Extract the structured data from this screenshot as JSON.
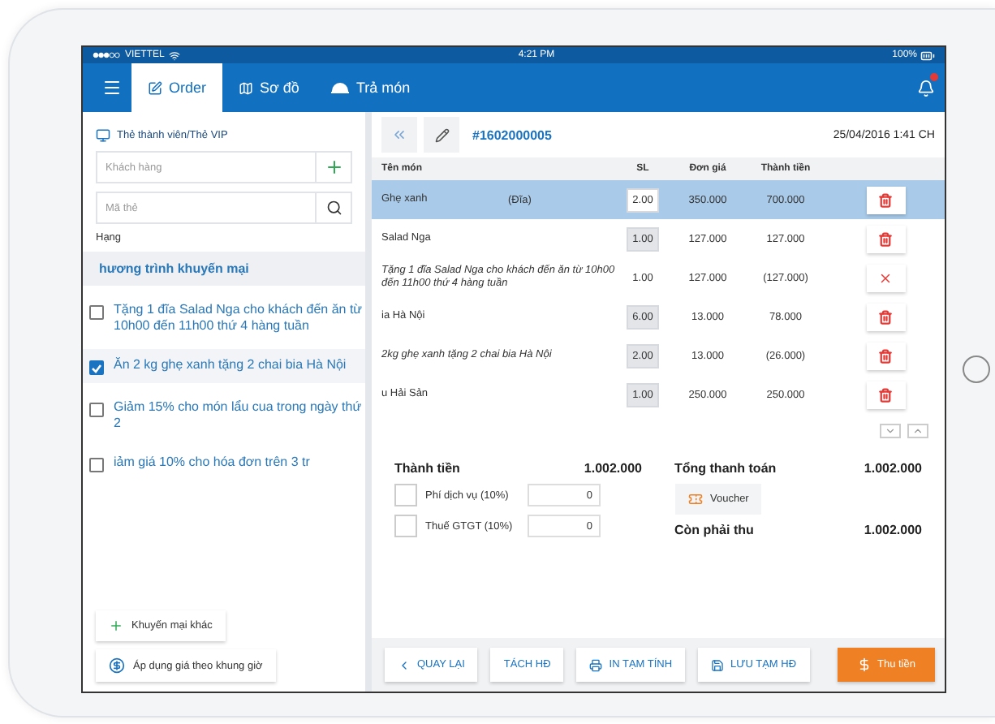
{
  "status_bar": {
    "carrier": "VIETTEL",
    "time": "4:21 PM",
    "battery": "100%"
  },
  "nav": {
    "tabs": [
      {
        "label": "Order",
        "selected": true
      },
      {
        "label": "Sơ đồ",
        "selected": false
      },
      {
        "label": "Trả món",
        "selected": false
      }
    ]
  },
  "left_panel": {
    "member_title": "Thẻ thành viên/Thẻ VIP",
    "customer_field": {
      "placeholder": "Khách hàng"
    },
    "card_field": {
      "placeholder": "Mã thẻ"
    },
    "rank_label": "Hạng",
    "promo_title": "hương trình khuyến mại",
    "promotions": [
      {
        "text": "Tặng 1 đĩa Salad Nga cho khách đến ăn từ 10h00 đến 11h00 thứ 4 hàng tuần",
        "checked": false
      },
      {
        "text": "Ăn 2 kg ghẹ xanh tặng 2 chai bia Hà Nội",
        "checked": true
      },
      {
        "text": "Giảm 15% cho món lẩu cua trong ngày thứ 2",
        "checked": false
      },
      {
        "text": "iảm giá 10% cho hóa đơn trên 3 tr",
        "checked": false
      }
    ],
    "more_button": "Khuyến mại khác",
    "time_price_button": "Áp dụng giá theo khung giờ"
  },
  "order": {
    "number": "#1602000005",
    "datetime": "25/04/2016 1:41 CH",
    "columns": [
      "Tên món",
      "SL",
      "Đơn giá",
      "Thành tiền"
    ],
    "rows": [
      {
        "name": "Ghẹ xanh",
        "unit": "(Đĩa)",
        "kind": "item",
        "qty": "2.00",
        "qty_box": true,
        "price": "350.000",
        "total": "700.000",
        "deletable": true,
        "selected": true
      },
      {
        "name": "Salad Nga",
        "kind": "item",
        "qty": "1.00",
        "qty_box": true,
        "price": "127.000",
        "total": "127.000",
        "deletable": true,
        "selected": false
      },
      {
        "name": "Tặng 1 đĩa Salad Nga cho khách đến ăn từ 10h00 đến 11h00 thứ 4 hàng tuần",
        "kind": "promo",
        "qty": "1.00",
        "qty_box": false,
        "price": "127.000",
        "total": "(127.000)",
        "deletable": false,
        "selected": false
      },
      {
        "name": "ia Hà Nội",
        "kind": "item",
        "qty": "6.00",
        "qty_box": true,
        "price": "13.000",
        "total": "78.000",
        "deletable": true,
        "selected": false
      },
      {
        "name": "2kg ghẹ xanh tặng 2 chai bia Hà Nội",
        "kind": "promo",
        "qty": "2.00",
        "qty_box": true,
        "price": "13.000",
        "total": "(26.000)",
        "deletable": true,
        "selected": false
      },
      {
        "name": "u Hải Sản",
        "kind": "item",
        "qty": "1.00",
        "qty_box": true,
        "price": "250.000",
        "total": "250.000",
        "deletable": true,
        "selected": false
      }
    ]
  },
  "totals": {
    "subtotal_label": "Thành tiền",
    "subtotal": "1.002.000",
    "fees": [
      {
        "label": "Phí dịch vụ (10%)",
        "value": "0",
        "checked": false
      },
      {
        "label": "Thuế GTGT (10%)",
        "value": "0",
        "checked": false
      }
    ],
    "grand_label": "Tổng thanh toán",
    "grand": "1.002.000",
    "voucher_button": "Voucher",
    "due_label": "Còn phải thu",
    "due": "1.002.000"
  },
  "footer_buttons": [
    {
      "label": "QUAY LẠI",
      "kind": "plain"
    },
    {
      "label": "TÁCH HĐ",
      "kind": "plain"
    },
    {
      "label": "IN TẠM TÍNH",
      "kind": "plain"
    },
    {
      "label": "LƯU TẠM HĐ",
      "kind": "plain"
    },
    {
      "label": "Thu tiền",
      "kind": "primary"
    }
  ]
}
